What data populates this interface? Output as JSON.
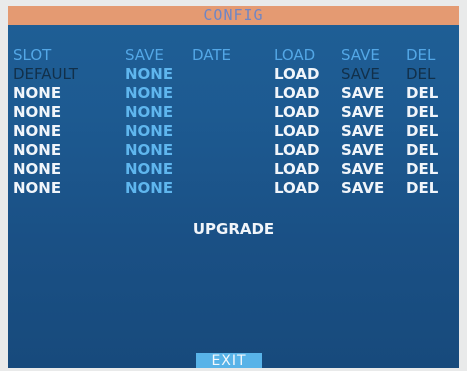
{
  "title": "CONFIG",
  "headers": {
    "slot": "SLOT",
    "save": "SAVE",
    "date": "DATE",
    "load": "LOAD",
    "save2": "SAVE",
    "del": "DEL"
  },
  "rows": [
    {
      "slot": "DEFAULT",
      "save": "NONE",
      "date": "",
      "load": "LOAD",
      "save2": "SAVE",
      "del": "DEL"
    },
    {
      "slot": "NONE",
      "save": "NONE",
      "date": "",
      "load": "LOAD",
      "save2": "SAVE",
      "del": "DEL"
    },
    {
      "slot": "NONE",
      "save": "NONE",
      "date": "",
      "load": "LOAD",
      "save2": "SAVE",
      "del": "DEL"
    },
    {
      "slot": "NONE",
      "save": "NONE",
      "date": "",
      "load": "LOAD",
      "save2": "SAVE",
      "del": "DEL"
    },
    {
      "slot": "NONE",
      "save": "NONE",
      "date": "",
      "load": "LOAD",
      "save2": "SAVE",
      "del": "DEL"
    },
    {
      "slot": "NONE",
      "save": "NONE",
      "date": "",
      "load": "LOAD",
      "save2": "SAVE",
      "del": "DEL"
    },
    {
      "slot": "NONE",
      "save": "NONE",
      "date": "",
      "load": "LOAD",
      "save2": "SAVE",
      "del": "DEL"
    }
  ],
  "upgrade_label": "UPGRADE",
  "exit_label": "EXIT",
  "colors": {
    "title_bar": "#e49a72",
    "background": "#1d5a91",
    "header_text": "#53a7e6",
    "value_text": "#5fb6ee",
    "selected_text": "#12304a",
    "exit_button": "#58b3e8"
  }
}
